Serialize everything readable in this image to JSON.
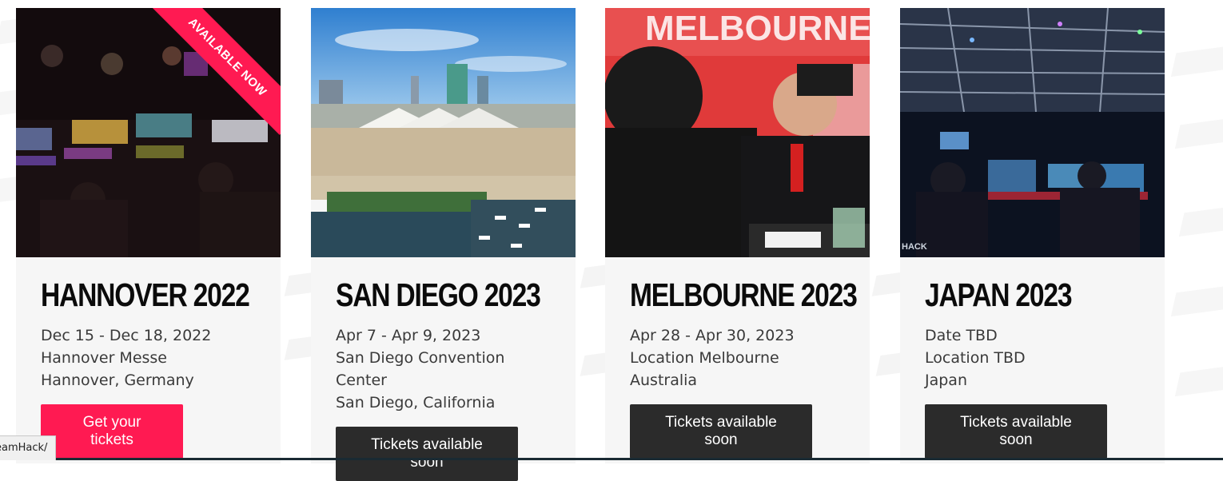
{
  "events": [
    {
      "title": "HANNOVER 2022",
      "date": "Dec 15 - Dec 18, 2022",
      "venue_lines": [
        "Hannover Messe",
        "Hannover, Germany"
      ],
      "button": "Get your tickets",
      "button_state": "primary",
      "ribbon": "AVAILABLE NOW"
    },
    {
      "title": "SAN DIEGO 2023",
      "date": "Apr 7 - Apr 9, 2023",
      "venue_lines": [
        "San Diego Convention",
        "Center",
        "San Diego, California"
      ],
      "button": "Tickets available soon",
      "button_state": "disabled"
    },
    {
      "title": "MELBOURNE 2023",
      "date": "Apr 28 - Apr 30, 2023",
      "venue_lines": [
        "Location Melbourne",
        "Australia"
      ],
      "button": "Tickets available soon",
      "button_state": "disabled",
      "photo_sign": "MELBOURNE"
    },
    {
      "title": "JAPAN 2023",
      "date": "Date TBD",
      "venue_lines": [
        "Location TBD",
        "Japan"
      ],
      "button": "Tickets available soon",
      "button_state": "disabled",
      "photo_watermark": "HACK"
    }
  ],
  "status_bar": "eamHack/",
  "colors": {
    "accent": "#ff1a52",
    "dark_button": "#2b2b2b",
    "card_bg": "#f6f6f6",
    "title": "#0b0b0b",
    "text": "#3a3a3a"
  }
}
